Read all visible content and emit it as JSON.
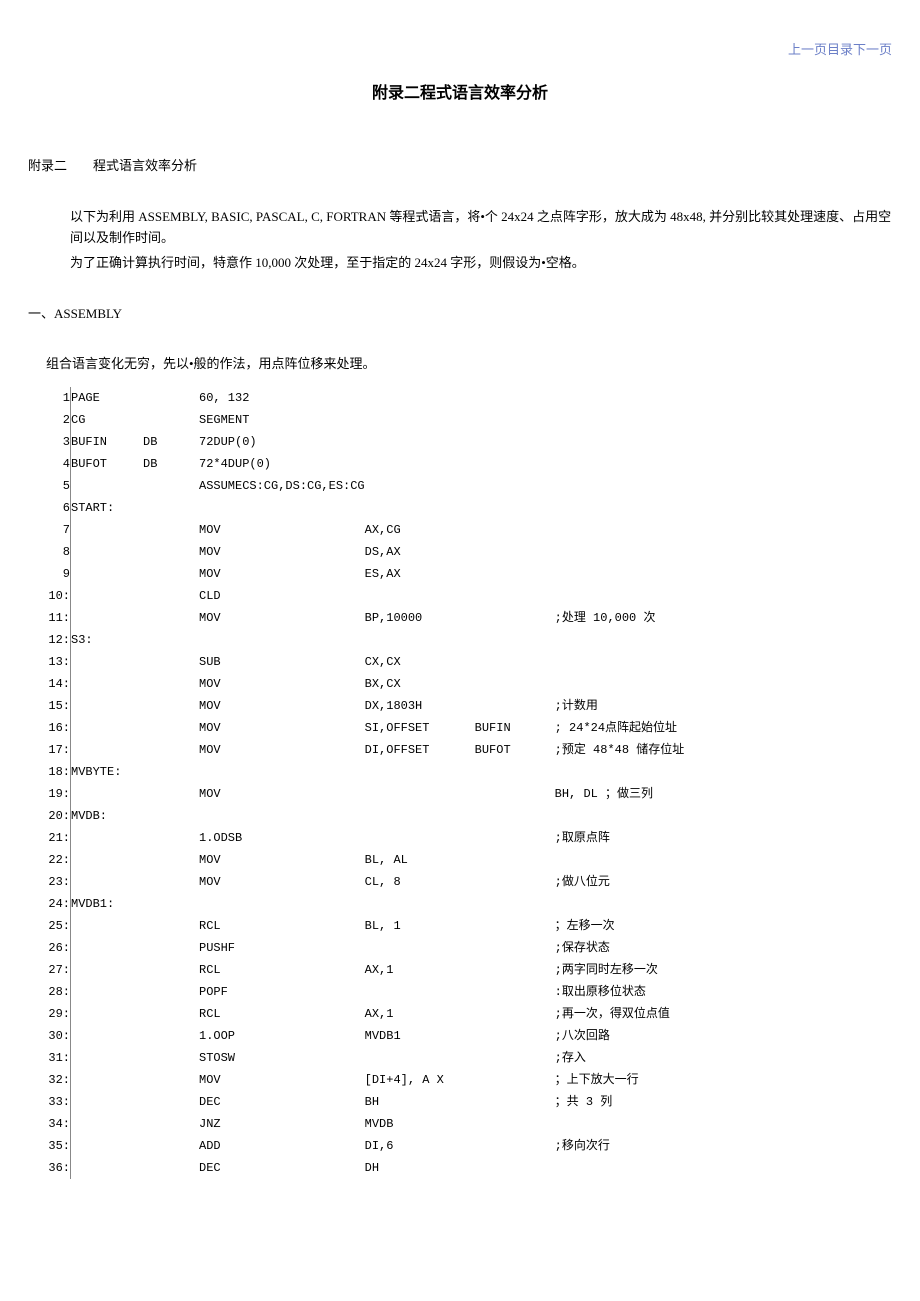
{
  "nav": {
    "prev": "上一页",
    "toc": "目录",
    "next": "下一页"
  },
  "title": "附录二程式语言效率分析",
  "section_heading_a": "附录二",
  "section_heading_b": "程式语言效率分析",
  "para1": "以下为利用 ASSEMBLY, BASIC, PASCAL, C, FORTRAN 等程式语言，将•个 24x24 之点阵字形，放大成为 48x48, 并分别比较其处理速度、占用空间以及制作时间。",
  "para2": "为了正确计算执行时间，特意作 10,000 次处理，至于指定的 24x24 字形，则假设为•空格。",
  "sec1_title": "一、ASSEMBLY",
  "sec1_intro": "组合语言变化无穷，先以•般的作法，用点阵位移来处理。",
  "code": [
    {
      "n": "1",
      "label": "PAGE",
      "dir": "",
      "op": "60,  132",
      "arg": "",
      "arg2": "",
      "c": ""
    },
    {
      "n": "2",
      "label": "CG",
      "dir": "",
      "op": "SEGMENT",
      "arg": "",
      "arg2": "",
      "c": ""
    },
    {
      "n": "3",
      "label": "BUFIN",
      "dir": "DB",
      "op": "     72DUP(0)",
      "arg": "",
      "arg2": "",
      "c": ""
    },
    {
      "n": "4",
      "label": "BUFOT",
      "dir": "DB",
      "op": "72*4DUP(0)",
      "arg": "",
      "arg2": "",
      "c": ""
    },
    {
      "n": "5",
      "label": "",
      "dir": "",
      "op": "ASSUMECS:CG,DS:CG,ES:CG",
      "arg": "",
      "arg2": "",
      "c": ""
    },
    {
      "n": "6",
      "label": "START:",
      "dir": "",
      "op": "",
      "arg": "",
      "arg2": "",
      "c": ""
    },
    {
      "n": "7",
      "label": "",
      "dir": "",
      "op": "MOV",
      "arg": "AX,CG",
      "arg2": "",
      "c": ""
    },
    {
      "n": "8",
      "label": "",
      "dir": "",
      "op": "MOV",
      "arg": "DS,AX",
      "arg2": "",
      "c": ""
    },
    {
      "n": "9",
      "label": "",
      "dir": "",
      "op": "MOV",
      "arg": "ES,AX",
      "arg2": "",
      "c": ""
    },
    {
      "n": "10:",
      "label": "",
      "dir": "",
      "op": "CLD",
      "arg": "",
      "arg2": "",
      "c": ""
    },
    {
      "n": "11:",
      "label": "",
      "dir": "",
      "op": "MOV",
      "arg": "BP,10000",
      "arg2": "",
      "c": ";处理 10,000 次"
    },
    {
      "n": "12:",
      "label": "S3:",
      "dir": "",
      "op": "",
      "arg": "",
      "arg2": "",
      "c": ""
    },
    {
      "n": "13:",
      "label": "",
      "dir": "",
      "op": "SUB",
      "arg": "CX,CX",
      "arg2": "",
      "c": ""
    },
    {
      "n": "14:",
      "label": "",
      "dir": "",
      "op": "MOV",
      "arg": "BX,CX",
      "arg2": "",
      "c": ""
    },
    {
      "n": "15:",
      "label": "",
      "dir": "",
      "op": "MOV",
      "arg": "DX,1803H",
      "arg2": "",
      "c": "         ;计数用"
    },
    {
      "n": "16:",
      "label": "",
      "dir": "",
      "op": "MOV",
      "arg": "SI,OFFSET",
      "arg2": "BUFIN",
      "c": ";  24*24点阵起始位址"
    },
    {
      "n": "17:",
      "label": "",
      "dir": "",
      "op": "MOV",
      "arg": "DI,OFFSET",
      "arg2": "BUFOT",
      "c": ";预定 48*48   储存位址"
    },
    {
      "n": "18:",
      "label": "MVBYTE:",
      "dir": "",
      "op": "",
      "arg": "",
      "arg2": "",
      "c": ""
    },
    {
      "n": "19:",
      "label": "",
      "dir": "",
      "op": "MOV",
      "arg": "",
      "arg2": "",
      "c": "BH,        DL      ；做三列"
    },
    {
      "n": "20:",
      "label": "MVDB:",
      "dir": "",
      "op": "",
      "arg": "",
      "arg2": "",
      "c": ""
    },
    {
      "n": "21:",
      "label": "",
      "dir": "",
      "op": "1.ODSB",
      "arg": "",
      "arg2": "",
      "c": ";取原点阵"
    },
    {
      "n": "22:",
      "label": "",
      "dir": "",
      "op": "MOV",
      "arg": "BL, AL",
      "arg2": "",
      "c": ""
    },
    {
      "n": "23:",
      "label": "",
      "dir": "",
      "op": "MOV",
      "arg": "CL,  8",
      "arg2": "",
      "c": ";做八位元"
    },
    {
      "n": "24:",
      "label": "MVDB1:",
      "dir": "",
      "op": "",
      "arg": "",
      "arg2": "",
      "c": ""
    },
    {
      "n": "25:",
      "label": "",
      "dir": "",
      "op": "RCL",
      "arg": "BL,  1",
      "arg2": "",
      "c": "；左移一次"
    },
    {
      "n": "26:",
      "label": "",
      "dir": "",
      "op": "PUSHF",
      "arg": "",
      "arg2": "",
      "c": ";保存状态"
    },
    {
      "n": "27:",
      "label": "",
      "dir": "",
      "op": "RCL",
      "arg": " AX,1",
      "arg2": "",
      "c": ";两字同时左移一次"
    },
    {
      "n": "28:",
      "label": "",
      "dir": "",
      "op": "POPF",
      "arg": "",
      "arg2": "",
      "c": ":取出原移位状态"
    },
    {
      "n": "29:",
      "label": "",
      "dir": "",
      "op": "RCL",
      "arg": " AX,1",
      "arg2": "",
      "c": ";再一次，得双位点值"
    },
    {
      "n": "30:",
      "label": "",
      "dir": "",
      "op": "1.OOP",
      "arg": "MVDB1",
      "arg2": "",
      "c": ";八次回路"
    },
    {
      "n": "31:",
      "label": "",
      "dir": "",
      "op": "STOSW",
      "arg": "",
      "arg2": "",
      "c": ";存入"
    },
    {
      "n": "32:",
      "label": "",
      "dir": "",
      "op": "MOV",
      "arg": " [DI+4], A X",
      "arg2": "",
      "c": "；上下放大一行"
    },
    {
      "n": "33:",
      "label": "",
      "dir": "",
      "op": "DEC",
      "arg": " BH",
      "arg2": "",
      "c": "；共 3 列"
    },
    {
      "n": "34:",
      "label": "",
      "dir": "",
      "op": "JNZ",
      "arg": "MVDB",
      "arg2": "",
      "c": ""
    },
    {
      "n": "35:",
      "label": "",
      "dir": "",
      "op": "ADD",
      "arg": " DI,6",
      "arg2": "",
      "c": ";移向次行"
    },
    {
      "n": "36:",
      "label": "",
      "dir": "",
      "op": "DEC",
      "arg": "DH",
      "arg2": "",
      "c": ""
    }
  ]
}
